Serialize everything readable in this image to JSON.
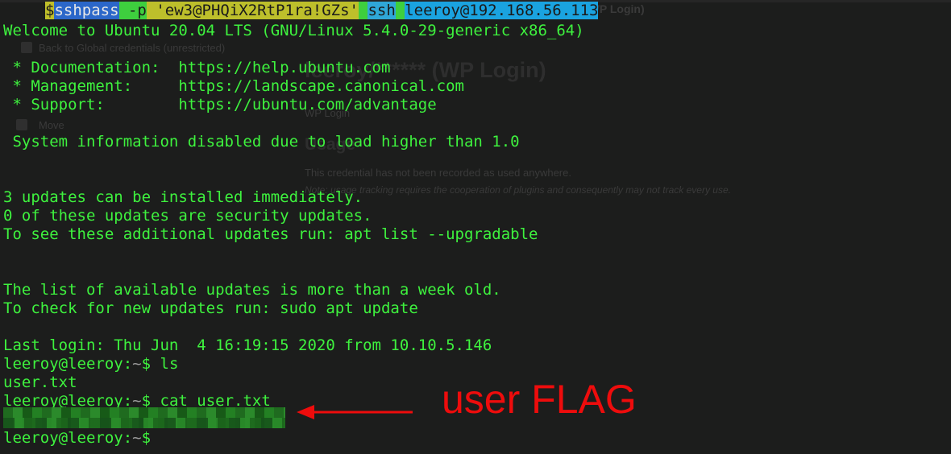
{
  "background_window": {
    "title_right": "(WP Login)",
    "back_link": "Back to Global credentials (unrestricted)",
    "heading": "leeroy/****** (WP Login)",
    "subheading": "WP Login",
    "usage_title": "Usage",
    "usage_text": "This credential has not been recorded as used anywhere.",
    "usage_note": "Note: usage tracking requires the cooperation of plugins and consequently may not track every use.",
    "menu_move": "Move"
  },
  "command": {
    "dollar": "$",
    "sshpass": "sshpass",
    "flag": "-p",
    "password": "'ew3@PHQiX2RtP1ra!GZs'",
    "ssh": "ssh",
    "target": "leeroy@192.168.56.113"
  },
  "motd": {
    "welcome": "Welcome to Ubuntu 20.04 LTS (GNU/Linux 5.4.0-29-generic x86_64)",
    "doc": " * Documentation:  https://help.ubuntu.com",
    "mgmt": " * Management:     https://landscape.canonical.com",
    "support": " * Support:        https://ubuntu.com/advantage",
    "sysinfo": " System information disabled due to load higher than 1.0",
    "updates1": "3 updates can be installed immediately.",
    "updates2": "0 of these updates are security updates.",
    "updates3": "To see these additional updates run: apt list --upgradable",
    "old1": "The list of available updates is more than a week old.",
    "old2": "To check for new updates run: sudo apt update",
    "lastlogin": "Last login: Thu Jun  4 16:19:15 2020 from 10.10.5.146"
  },
  "session": {
    "user_host": "leeroy@leeroy",
    "sep": ":",
    "path": "~",
    "dollar": "$ ",
    "cmd1": "ls",
    "out1": "user.txt",
    "cmd2": "cat user.txt"
  },
  "annotation": {
    "label": "user FLAG",
    "color": "#ee0c0c"
  },
  "colors": {
    "terminal_bg": "#1c1d1c",
    "terminal_fg": "#3ef23e"
  }
}
